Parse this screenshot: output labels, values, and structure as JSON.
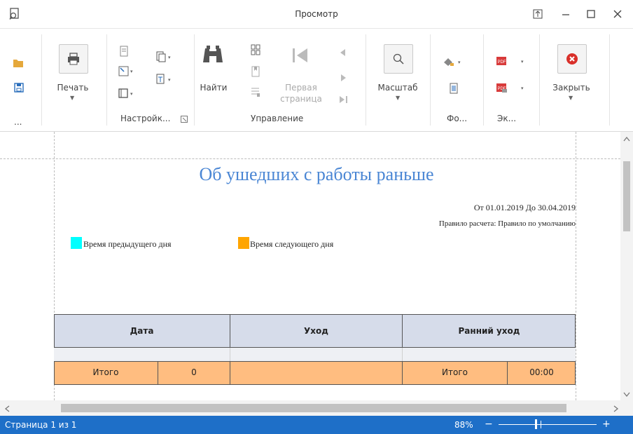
{
  "window": {
    "title": "Просмотр"
  },
  "ribbon": {
    "print_label": "Печать",
    "settings_group": "Настройк...",
    "find_label": "Найти",
    "first_page_line1": "Первая",
    "first_page_line2": "страница",
    "navigation_group": "Управление",
    "zoom_label": "Масштаб",
    "background_group": "Фо...",
    "export_group": "Эк...",
    "close_label": "Закрыть",
    "file_group": "..."
  },
  "report": {
    "title": "Об ушедших с работы раньше",
    "date_range": "От 01.01.2019 До 30.04.2019",
    "rule": "Правило расчета: Правило по умолчанию",
    "legend": [
      {
        "label": "Время предыдущего дня",
        "color": "#00ffff"
      },
      {
        "label": "Время следующего дня",
        "color": "#ffa500"
      }
    ],
    "columns": [
      "Дата",
      "Уход",
      "Ранний уход"
    ],
    "total_left_label": "Итого",
    "total_left_value": "0",
    "total_right_label": "Итого",
    "total_right_value": "00:00",
    "header_color": "#d6dcea",
    "total_color": "#ffbd80"
  },
  "status": {
    "page": "Страница 1 из 1",
    "zoom": "88%",
    "zoom_level": 0.88,
    "minus": "−",
    "plus": "+"
  },
  "colors": {
    "accent": "#1e6fc8",
    "title_blue": "#4a86d4"
  }
}
